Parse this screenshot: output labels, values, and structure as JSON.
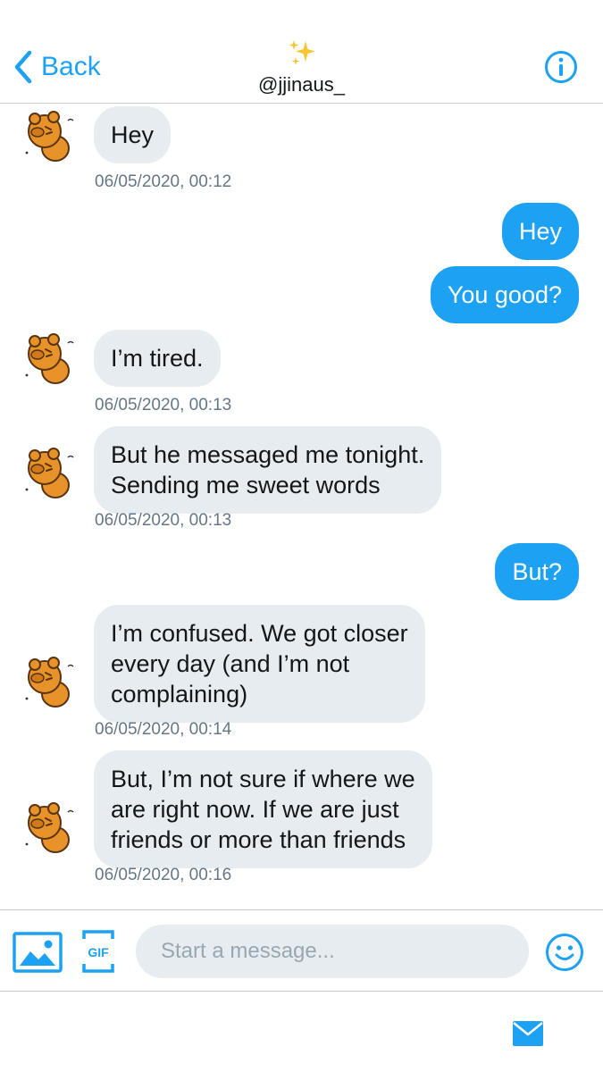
{
  "header": {
    "back_label": "Back",
    "sparkle_emoji": "✨",
    "handle": "@jjinaus_"
  },
  "messages": [
    {
      "direction": "in",
      "text": "Hey",
      "timestamp": "06/05/2020, 00:12"
    },
    {
      "direction": "out",
      "text": "Hey"
    },
    {
      "direction": "out",
      "text": "You good?"
    },
    {
      "direction": "in",
      "text": "I’m tired.",
      "timestamp": "06/05/2020, 00:13"
    },
    {
      "direction": "in",
      "text": "But he messaged me tonight.\nSending me sweet words",
      "timestamp": "06/05/2020, 00:13"
    },
    {
      "direction": "out",
      "text": "But?"
    },
    {
      "direction": "in",
      "text": "I’m confused. We got closer\nevery day (and I’m not\ncomplaining)",
      "timestamp": "06/05/2020, 00:14"
    },
    {
      "direction": "in",
      "text": "But, I’m not sure if where we\nare right now. If we are just\nfriends or more than friends",
      "timestamp": "06/05/2020, 00:16"
    }
  ],
  "composer": {
    "gif_label": "GIF",
    "placeholder": "Start a message..."
  },
  "icons": {
    "back": "chevron-left-icon",
    "info": "info-icon",
    "image": "image-icon",
    "gif": "gif-icon",
    "emoji": "smiley-icon",
    "messages": "mail-icon"
  },
  "colors": {
    "accent": "#1da1f2",
    "incoming_bubble": "#e6ecf0",
    "timestamp": "#657786",
    "avatar": "#e8922a"
  }
}
